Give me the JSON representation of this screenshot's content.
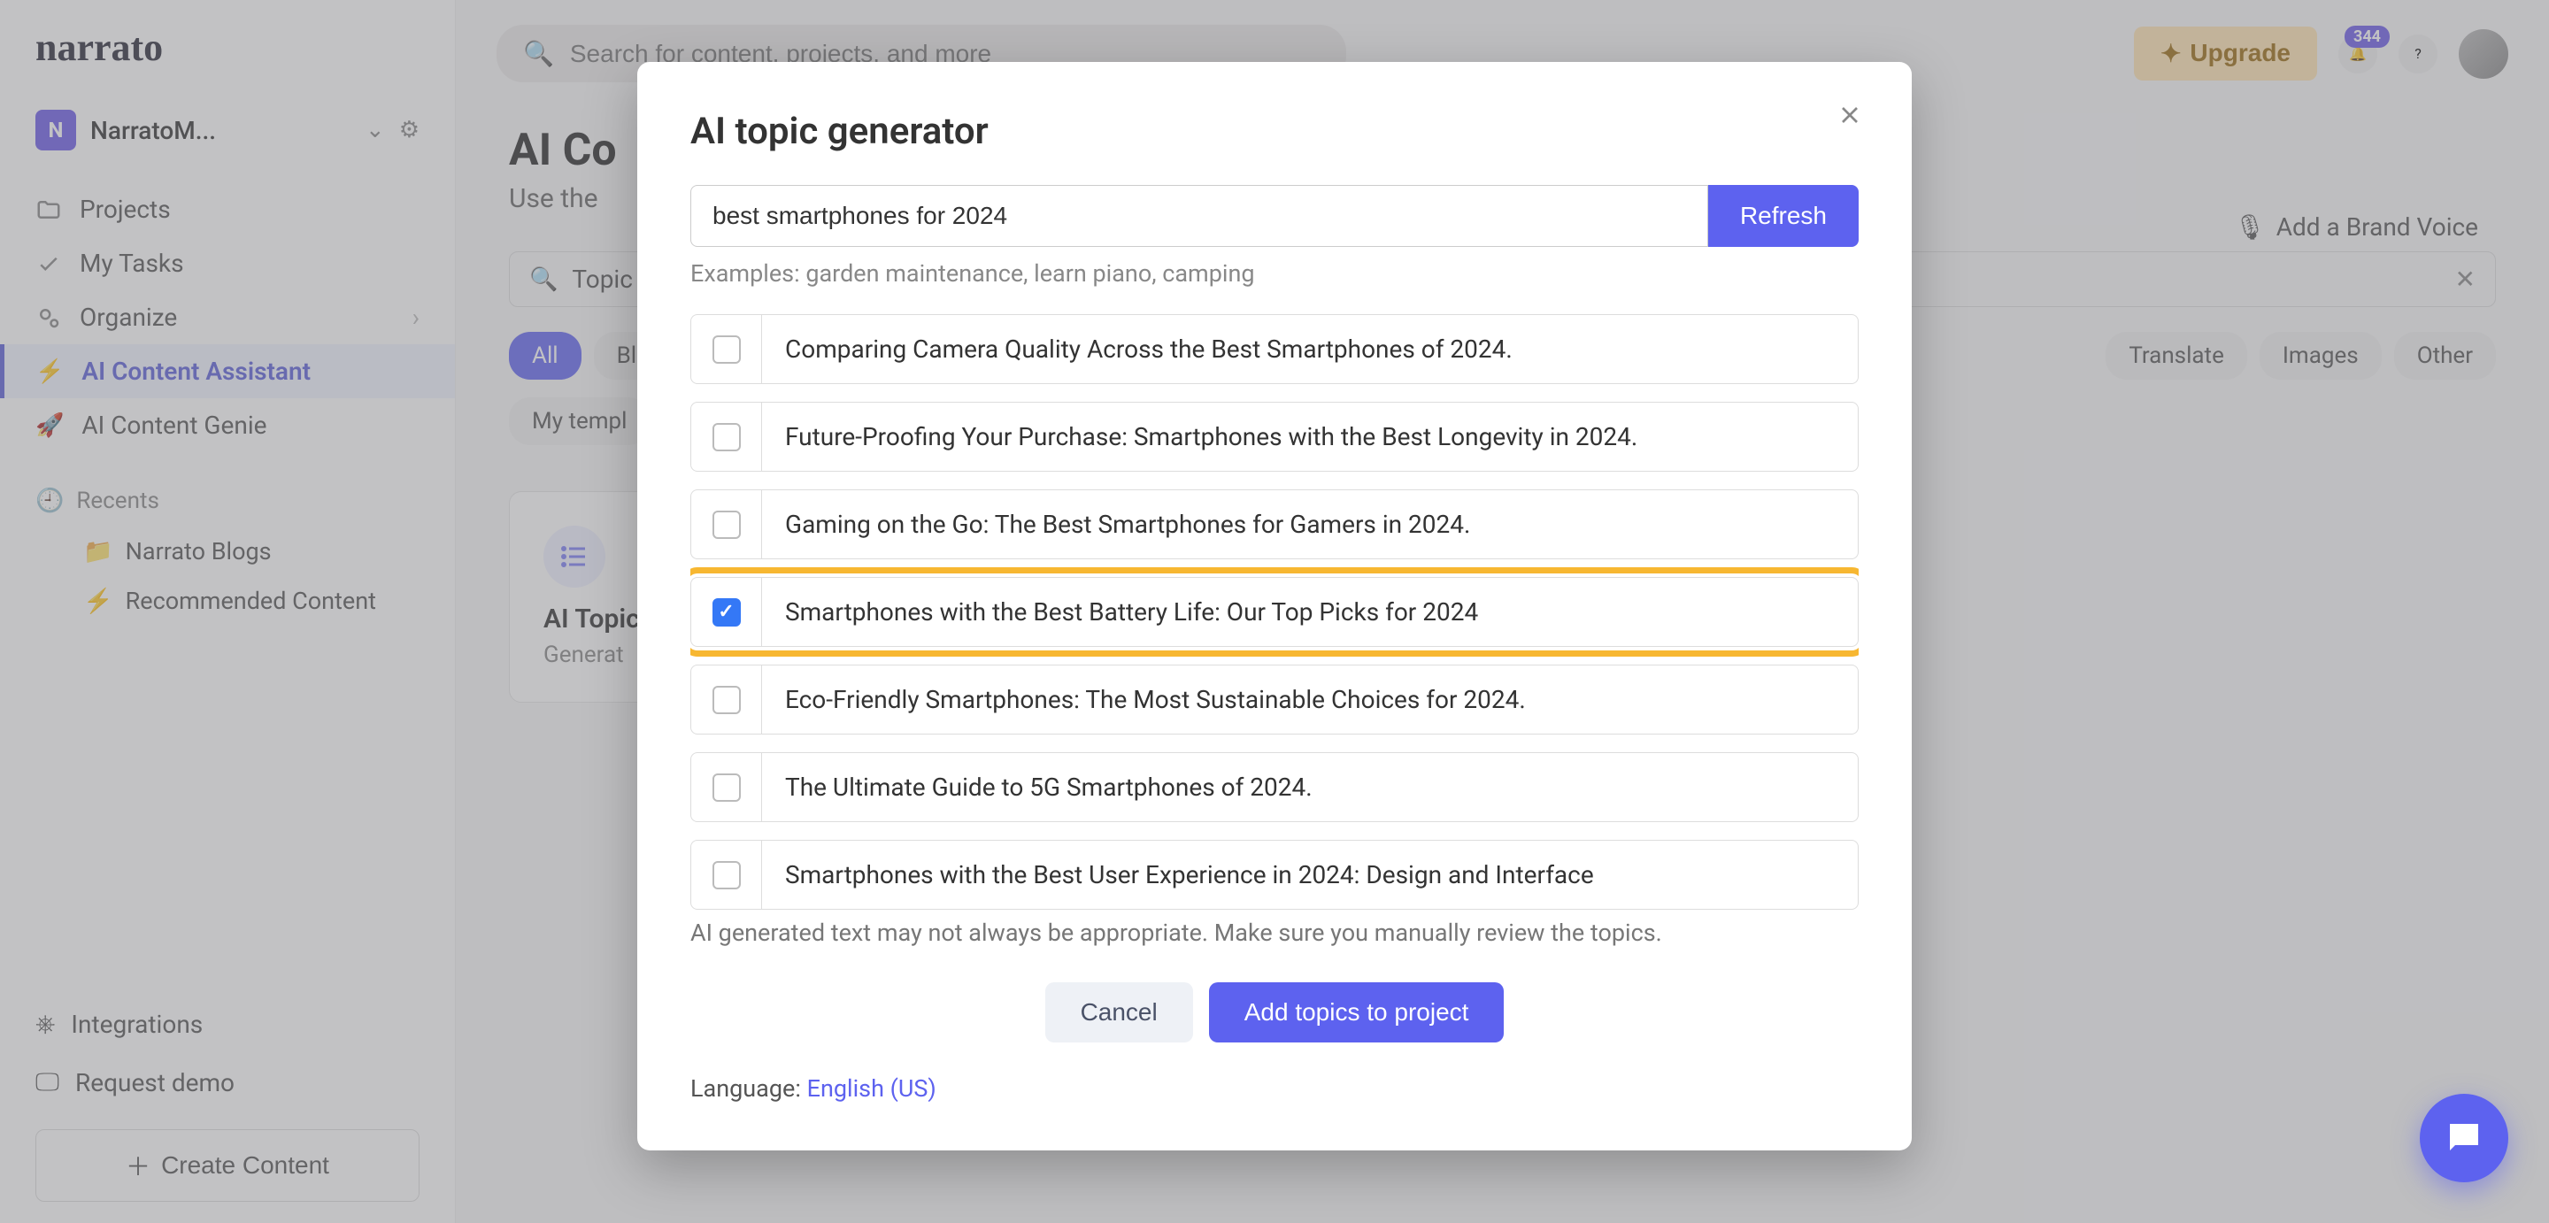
{
  "workspace": {
    "badge": "N",
    "name": "NarratoM..."
  },
  "sidebar": {
    "projects": "Projects",
    "tasks": "My Tasks",
    "organize": "Organize",
    "assistant": "AI Content Assistant",
    "genie": "AI Content Genie",
    "recents_label": "Recents",
    "recent_items": [
      "Narrato Blogs",
      "Recommended Content"
    ],
    "integrations": "Integrations",
    "request_demo": "Request demo",
    "create": "Create Content"
  },
  "topbar": {
    "search_placeholder": "Search for content, projects, and more",
    "upgrade": "Upgrade",
    "notif_count": "344"
  },
  "page": {
    "title_partial": "AI Co",
    "subtitle_partial": "Use the",
    "brand_voice": "Add a Brand Voice",
    "filter_text": "Topic",
    "pills": [
      "All",
      "Bl",
      "Translate",
      "Images",
      "Other"
    ],
    "my_templates": "My templ",
    "card_title": "AI Topic",
    "card_sub": "Generat"
  },
  "modal": {
    "title": "AI topic generator",
    "input_value": "best smartphones for 2024",
    "refresh": "Refresh",
    "examples": "Examples: garden maintenance, learn piano, camping",
    "topics": [
      {
        "text": "Comparing Camera Quality Across the Best Smartphones of 2024.",
        "checked": false,
        "highlight": false
      },
      {
        "text": "Future-Proofing Your Purchase: Smartphones with the Best Longevity in 2024.",
        "checked": false,
        "highlight": false
      },
      {
        "text": "Gaming on the Go: The Best Smartphones for Gamers in 2024.",
        "checked": false,
        "highlight": false
      },
      {
        "text": "Smartphones with the Best Battery Life: Our Top Picks for 2024",
        "checked": true,
        "highlight": true
      },
      {
        "text": "Eco-Friendly Smartphones: The Most Sustainable Choices for 2024.",
        "checked": false,
        "highlight": false
      },
      {
        "text": "The Ultimate Guide to 5G Smartphones of 2024.",
        "checked": false,
        "highlight": false
      },
      {
        "text": "Smartphones with the Best User Experience in 2024: Design and Interface",
        "checked": false,
        "highlight": false
      }
    ],
    "disclaimer": "AI generated text may not always be appropriate. Make sure you manually review the topics.",
    "cancel": "Cancel",
    "add": "Add topics to project",
    "lang_label": "Language: ",
    "lang_value": "English (US)"
  }
}
